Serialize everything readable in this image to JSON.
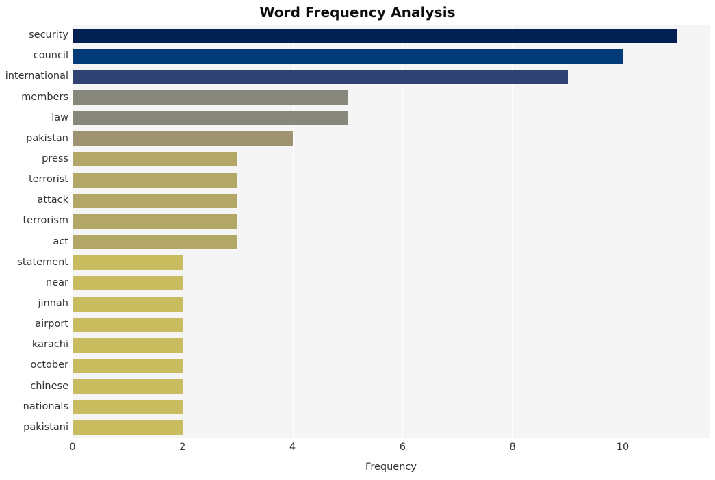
{
  "chart_data": {
    "type": "bar",
    "orientation": "horizontal",
    "title": "Word Frequency Analysis",
    "xlabel": "Frequency",
    "ylabel": "",
    "categories": [
      "security",
      "council",
      "international",
      "members",
      "law",
      "pakistan",
      "press",
      "terrorist",
      "attack",
      "terrorism",
      "act",
      "statement",
      "near",
      "jinnah",
      "airport",
      "karachi",
      "october",
      "chinese",
      "nationals",
      "pakistani"
    ],
    "values": [
      11,
      10,
      9,
      5,
      5,
      4,
      3,
      3,
      3,
      3,
      3,
      2,
      2,
      2,
      2,
      2,
      2,
      2,
      2,
      2
    ],
    "bar_colors": [
      "#022051",
      "#033b79",
      "#2f4272",
      "#87877c",
      "#87877c",
      "#9f9472",
      "#b3a768",
      "#b3a768",
      "#b3a768",
      "#b3a768",
      "#b3a768",
      "#c9bc5e",
      "#c9bc5e",
      "#c9bc5e",
      "#c9bc5e",
      "#c9bc5e",
      "#c9bc5e",
      "#c9bc5e",
      "#c9bc5e",
      "#c9bc5e"
    ],
    "xlim": [
      0,
      11.58
    ],
    "x_ticks": [
      "0",
      "2",
      "4",
      "6",
      "8",
      "10"
    ],
    "x_tick_values": [
      0,
      2,
      4,
      6,
      8,
      10
    ],
    "grid": "vertical-white",
    "legend": "none",
    "plot_background": "#f5f5f6",
    "figure_background": "#ffffff",
    "title_color": "#0d0d0d",
    "tick_label_color": "#333333"
  }
}
